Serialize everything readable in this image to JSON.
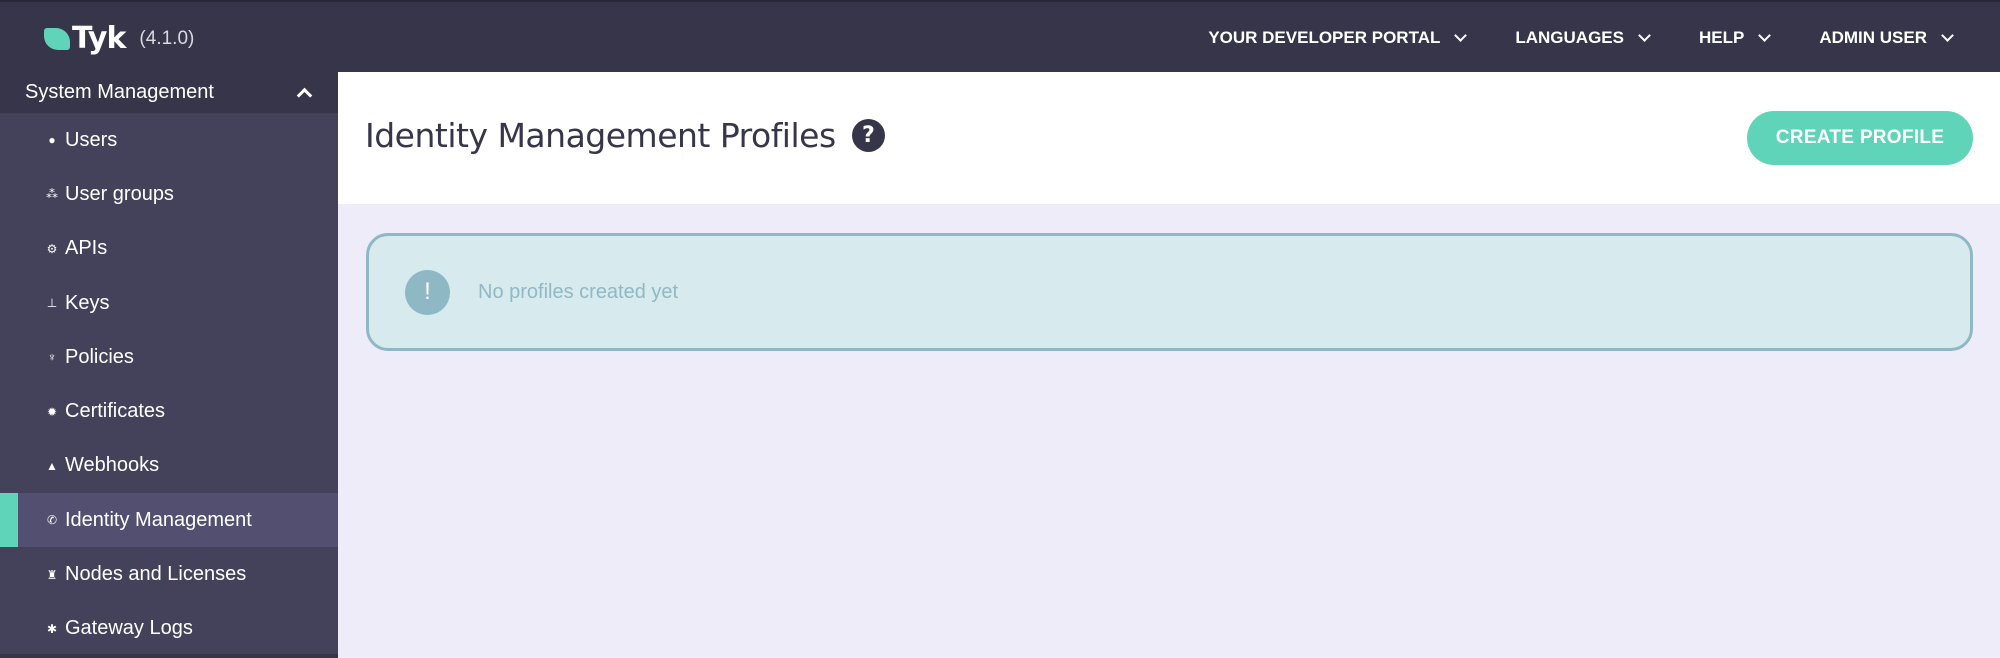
{
  "topbar": {
    "logo_text": "Tyk",
    "version": "(4.1.0)",
    "nav": [
      {
        "label": "YOUR DEVELOPER PORTAL",
        "icon": "chevron-down-icon"
      },
      {
        "label": "LANGUAGES",
        "icon": "chevron-down-icon"
      },
      {
        "label": "HELP",
        "icon": "chevron-down-icon"
      },
      {
        "label": "ADMIN USER",
        "icon": "chevron-down-icon"
      }
    ]
  },
  "sidebar": {
    "section_title": "System Management",
    "section_icon": "chevron-up-icon",
    "items": [
      {
        "label": "Users",
        "icon": "user-icon",
        "glyph": "👤",
        "active": false
      },
      {
        "label": "User groups",
        "icon": "users-icon",
        "glyph": "👥",
        "active": false
      },
      {
        "label": "APIs",
        "icon": "cogs-icon",
        "glyph": "⚙",
        "active": false
      },
      {
        "label": "Keys",
        "icon": "sitemap-icon",
        "glyph": "⊞",
        "active": false
      },
      {
        "label": "Policies",
        "icon": "plug-icon",
        "glyph": "⏚",
        "active": false
      },
      {
        "label": "Certificates",
        "icon": "certificate-icon",
        "glyph": "✹",
        "active": false
      },
      {
        "label": "Webhooks",
        "icon": "bell-icon",
        "glyph": "🔔",
        "active": false
      },
      {
        "label": "Identity Management",
        "icon": "phone-icon",
        "glyph": "✆",
        "active": true
      },
      {
        "label": "Nodes and Licenses",
        "icon": "bank-icon",
        "glyph": "🏛",
        "active": false
      },
      {
        "label": "Gateway Logs",
        "icon": "bug-icon",
        "glyph": "✱",
        "active": false
      }
    ]
  },
  "main": {
    "title": "Identity Management Profiles",
    "help_glyph": "?",
    "create_button": "CREATE PROFILE",
    "alert": {
      "icon_glyph": "!",
      "message": "No profiles created yet"
    }
  },
  "colors": {
    "accent": "#5fd4b9",
    "topbar": "#37354a",
    "sidebar": "#43425a",
    "sidebar_active": "#524f70",
    "alert_bg": "#d7eaee",
    "alert_border": "#8fb8c5"
  }
}
